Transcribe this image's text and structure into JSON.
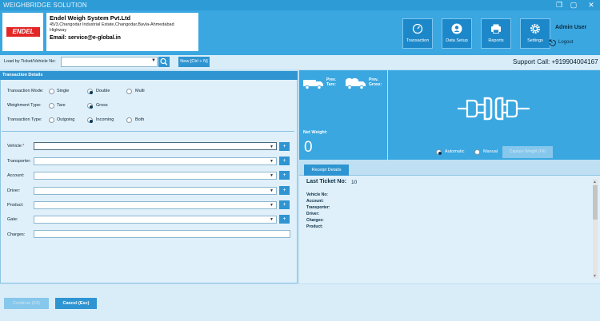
{
  "window": {
    "title": "WEIGHBRIDGE SOLUTION",
    "controls": [
      "restore-icon",
      "maximize-icon",
      "close-icon"
    ]
  },
  "logo": {
    "text": "ENDEL"
  },
  "company": {
    "name": "Endel Weigh System Pvt.Ltd",
    "address": "45/3,Changodar Industrial Estate,Changodar,Bavla-Ahmedabad Highway",
    "email": "Email: service@e-global.in"
  },
  "nav": [
    {
      "label": "Transaction",
      "icon": "gauge-icon"
    },
    {
      "label": "Data Setup",
      "icon": "user-icon"
    },
    {
      "label": "Reports",
      "icon": "printer-icon"
    },
    {
      "label": "Settings",
      "icon": "gear-icon"
    }
  ],
  "user": {
    "name": "Admin User",
    "logout": "Logout"
  },
  "load": {
    "label": "Load by Ticket/Vehicle No:",
    "value": "",
    "new_label": "New [Ctrl + N]"
  },
  "support": "Support Call: +919904004167",
  "transaction": {
    "title": "Transaction Details",
    "mode": {
      "label": "Transaction Mode:",
      "options": [
        "Single",
        "Double",
        "Multi"
      ],
      "selected": "Double"
    },
    "weighment": {
      "label": "Weighment Type:",
      "options": [
        "Tare",
        "Gross"
      ],
      "selected": "Gross"
    },
    "type": {
      "label": "Transaction Type:",
      "options": [
        "Outgoing",
        "Incoming",
        "Both"
      ],
      "selected": "Incoming"
    },
    "fields": [
      {
        "label": "Vehicle:",
        "required": "*",
        "value": ""
      },
      {
        "label": "Transporter:",
        "value": ""
      },
      {
        "label": "Account:",
        "value": ""
      },
      {
        "label": "Driver:",
        "value": ""
      },
      {
        "label": "Product:",
        "value": ""
      },
      {
        "label": "Gate:",
        "value": ""
      }
    ],
    "charges": {
      "label": "Charges:",
      "value": ""
    }
  },
  "weights": {
    "prev_tare": "Prev. Tare:",
    "prev_gross": "Prev. Gross:",
    "net_label": "Net Weight:",
    "net_value": "0"
  },
  "capture": {
    "automatic": "Automatic",
    "manual": "Manual",
    "selected": "Automatic",
    "button": "Capture Weight (F9)"
  },
  "receipt": {
    "tab": "Receipt Details",
    "last_ticket_label": "Last Ticket No:",
    "last_ticket_value": "10",
    "lines": [
      "Vehicle No:",
      "Account:",
      "Transporter:",
      "Driver:",
      "Charges:",
      "Product:"
    ]
  },
  "footer": {
    "continue": "Continue (F2)",
    "cancel": "Cancel (Esc)"
  },
  "colors": {
    "accent": "#2f95d2",
    "header": "#3aa7e0",
    "panel": "#dff0fa",
    "logo_red": "#e32626"
  }
}
